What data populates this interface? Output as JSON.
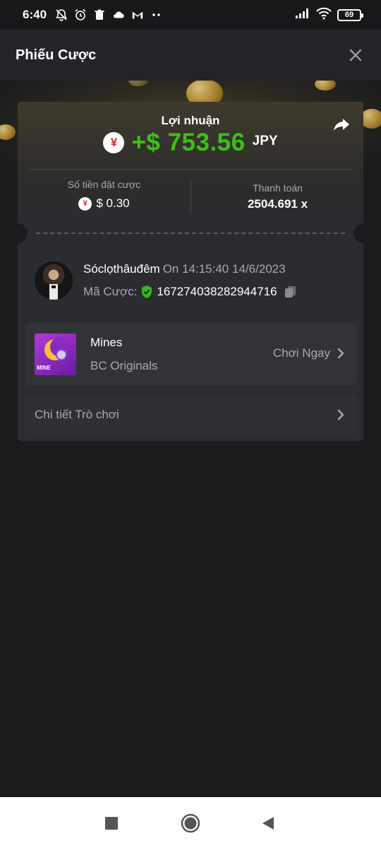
{
  "status_bar": {
    "time": "6:40",
    "battery": "69",
    "icons": [
      "bell-off-icon",
      "alarm-icon",
      "trash-icon",
      "cloud-icon",
      "gmail-icon",
      "more-dots-icon",
      "signal-icon",
      "wifi-icon",
      "battery-icon"
    ]
  },
  "header": {
    "title": "Phiếu Cược",
    "close_icon": "close-icon"
  },
  "profit": {
    "label": "Lợi nhuận",
    "amount": "+$ 753.56",
    "currency": "JPY",
    "currency_symbol": "¥",
    "share_icon": "share-icon"
  },
  "stats": {
    "bet_amount_label": "Số tiền đặt cược",
    "bet_amount_value": "$ 0.30",
    "payout_label": "Thanh toán",
    "payout_value": "2504.691 x"
  },
  "user": {
    "name": "Sóclọthâuđêm",
    "time_text": "On 14:15:40 14/6/2023",
    "bet_id_label": "Mã Cược:",
    "bet_id": "167274038282944716"
  },
  "game": {
    "name": "Mines",
    "provider": "BC Originals",
    "play_label": "Chơi Ngay",
    "thumb_tag": "MINE"
  },
  "details": {
    "label": "Chi tiết Trò chơi"
  },
  "colors": {
    "background": "#1b1c1e",
    "card": "#2b2c30",
    "profit_green": "#3bc117",
    "muted_text": "#a7a9ad"
  }
}
